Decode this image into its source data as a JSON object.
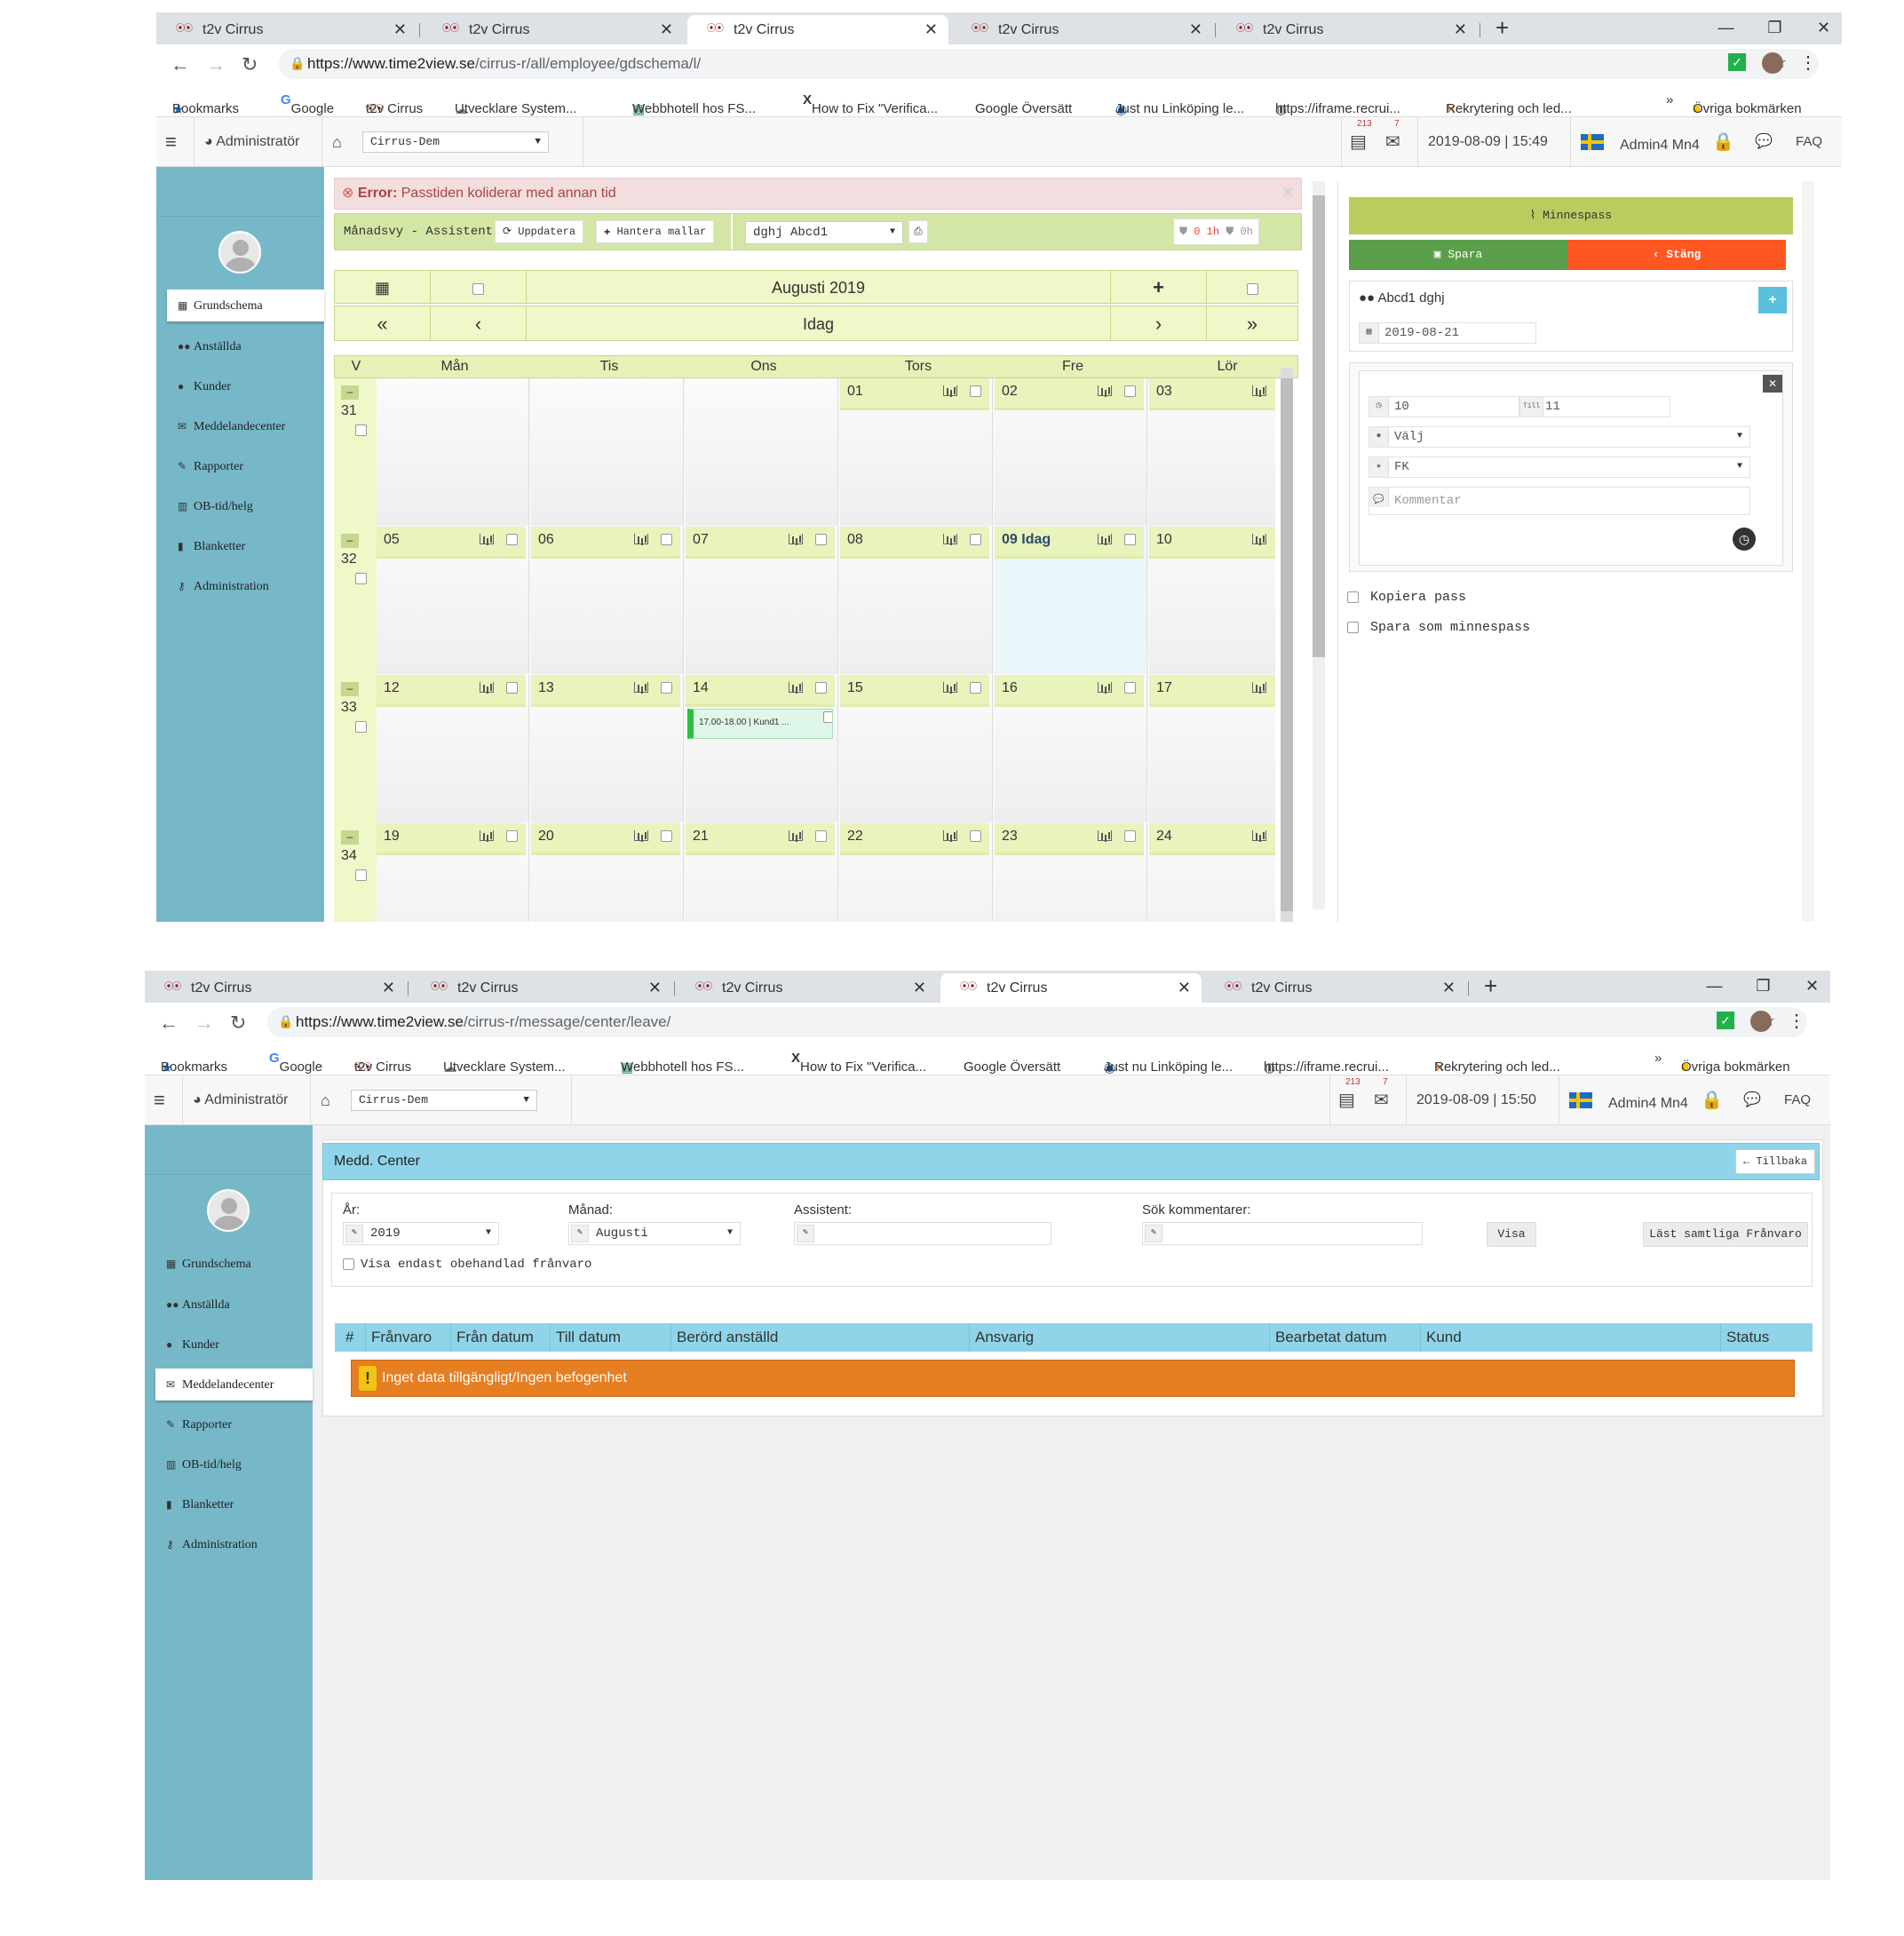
{
  "win1": {
    "tabs": [
      "t2v Cirrus",
      "t2v Cirrus",
      "t2v Cirrus",
      "t2v Cirrus",
      "t2v Cirrus"
    ],
    "url_host": "https://www.time2view.se",
    "url_path": "/cirrus-r/all/employee/gdschema/l/",
    "bookmarks": [
      "Bookmarks",
      "Google",
      "t2v Cirrus",
      "Utvecklare System...",
      "Webbhotell hos FS...",
      "How to Fix \"Verifica...",
      "Google Översätt",
      "Just nu Linköping le...",
      "https://iframe.recrui...",
      "Rekrytering och led...",
      "»",
      "Övriga bokmärken"
    ],
    "header": {
      "role": "Administratör",
      "company": "Cirrus-Dem",
      "badge1": "213",
      "badge2": "7",
      "datetime": "2019-08-09 | 15:49",
      "user": "Admin4 Mn4",
      "faq": "FAQ"
    },
    "sidebar": [
      {
        "label": "Grundschema",
        "icon": "calendar-icon",
        "active": true
      },
      {
        "label": "Anställda",
        "icon": "users-icon"
      },
      {
        "label": "Kunder",
        "icon": "user-icon"
      },
      {
        "label": "Meddelandecenter",
        "icon": "envelope-icon"
      },
      {
        "label": "Rapporter",
        "icon": "pencil-icon"
      },
      {
        "label": "OB-tid/helg",
        "icon": "chart-icon"
      },
      {
        "label": "Blanketter",
        "icon": "file-icon"
      },
      {
        "label": "Administration",
        "icon": "key-icon"
      }
    ],
    "error": {
      "prefix": "Error:",
      "message": " Passtiden koliderar med annan tid"
    },
    "controls": {
      "view": "Månadsvy - Assistent",
      "update": "Uppdatera",
      "templates": "Hantera mallar",
      "employee": "dghj Abcd1",
      "hours1": "0 1h",
      "hours2": "0h"
    },
    "calendar": {
      "month": "Augusti 2019",
      "today": "Idag",
      "days": [
        "V",
        "Mån",
        "Tis",
        "Ons",
        "Tors",
        "Fre",
        "Lör"
      ],
      "weeks": [
        {
          "week": "31",
          "dates": [
            "",
            "",
            "",
            "01",
            "02",
            "03"
          ]
        },
        {
          "week": "32",
          "dates": [
            "05",
            "06",
            "07",
            "08",
            "09 Idag",
            "10"
          ]
        },
        {
          "week": "33",
          "dates": [
            "12",
            "13",
            "14",
            "15",
            "16",
            "17"
          ]
        },
        {
          "week": "34",
          "dates": [
            "19",
            "20",
            "21",
            "22",
            "23",
            "24"
          ]
        }
      ],
      "event": "17.00-18.00 | Kund1 ..."
    },
    "right": {
      "memo": "Minnespass",
      "save": "Spara",
      "close": "Stäng",
      "customer": "Abcd1 dghj",
      "date": "2019-08-21",
      "from": "10",
      "till_label": "Till",
      "till": "11",
      "select": "Välj",
      "type": "FK",
      "comment_ph": "Kommentar",
      "copy": "Kopiera pass",
      "save_memo": "Spara som minnespass"
    }
  },
  "win2": {
    "tabs": [
      "t2v Cirrus",
      "t2v Cirrus",
      "t2v Cirrus",
      "t2v Cirrus",
      "t2v Cirrus"
    ],
    "url_host": "https://www.time2view.se",
    "url_path": "/cirrus-r/message/center/leave/",
    "header": {
      "role": "Administratör",
      "company": "Cirrus-Dem",
      "badge1": "213",
      "badge2": "7",
      "datetime": "2019-08-09 | 15:50",
      "user": "Admin4 Mn4",
      "faq": "FAQ"
    },
    "panel_title": "Medd. Center",
    "back": "Tillbaka",
    "filters": {
      "year_label": "År:",
      "year": "2019",
      "month_label": "Månad:",
      "month": "Augusti",
      "assist_label": "Assistent:",
      "search_label": "Sök kommentarer:",
      "show": "Visa",
      "read_all": "Läst samtliga Frånvaro",
      "only_unhandled": "Visa endast obehandlad frånvaro"
    },
    "columns": [
      "#",
      "Frånvaro",
      "Från datum",
      "Till datum",
      "Berörd anställd",
      "Ansvarig",
      "Bearbetat datum",
      "Kund",
      "Status"
    ],
    "nodata": "Inget data tillgängligt/Ingen befogenhet"
  },
  "colors": {
    "sidebar": "#77b8c8",
    "green_header": "#d4e6a5",
    "save": "#5a9e4a",
    "close": "#ff5722",
    "memo": "#b8cc5f",
    "table_header": "#8fd4e8",
    "warning": "#e67e22"
  }
}
